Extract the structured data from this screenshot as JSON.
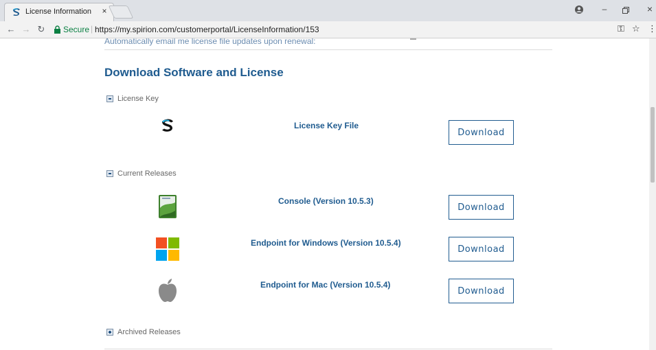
{
  "browser": {
    "tab_title": "License Information",
    "tab_close": "×",
    "secure_label": "Secure",
    "url": "https://my.spirion.com/customerportal/LicenseInformation/153"
  },
  "page": {
    "cutoff_text": "Automatically email me license file updates upon renewal:",
    "section_title": "Download Software and License",
    "groups": [
      {
        "label": "License Key",
        "expanded": true,
        "items": [
          {
            "name": "License Key File",
            "icon": "spirion-logo-icon",
            "button": "Download"
          }
        ]
      },
      {
        "label": "Current Releases",
        "expanded": true,
        "items": [
          {
            "name": "Console (Version 10.5.3)",
            "icon": "console-app-icon",
            "button": "Download"
          },
          {
            "name": "Endpoint for Windows (Version 10.5.4)",
            "icon": "windows-logo-icon",
            "button": "Download"
          },
          {
            "name": "Endpoint for Mac (Version 10.5.4)",
            "icon": "apple-logo-icon",
            "button": "Download"
          }
        ]
      },
      {
        "label": "Archived Releases",
        "expanded": false,
        "items": []
      }
    ]
  },
  "colors": {
    "link_blue": "#1f5b8f",
    "secure_green": "#0b8043"
  }
}
